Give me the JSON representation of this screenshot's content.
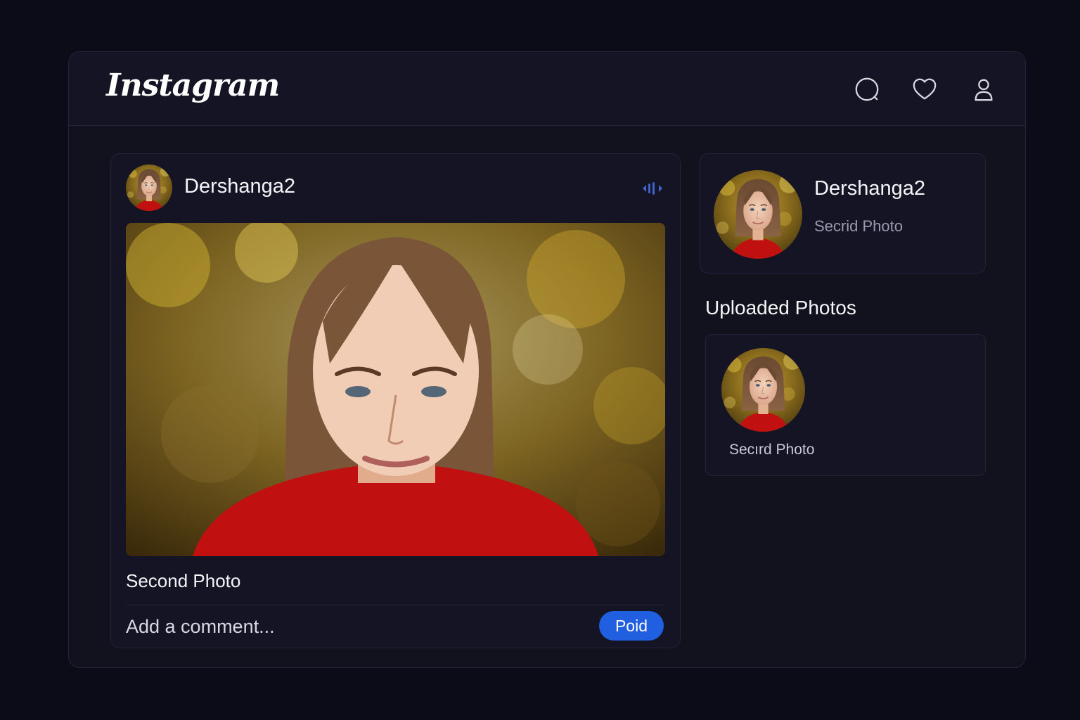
{
  "header": {
    "logo_text": "Instagram",
    "icons": [
      "search-icon",
      "heart-icon",
      "profile-icon"
    ]
  },
  "post": {
    "username": "Dershanga2",
    "caption": "Second Photo",
    "comment_placeholder": "Add a comment...",
    "post_button_label": "Poid"
  },
  "profile_card": {
    "username": "Dershanga2",
    "subtitle": "Secrid Photo"
  },
  "uploaded": {
    "heading": "Uploaded Photos",
    "items": [
      {
        "label": "Secırd Photo"
      }
    ]
  },
  "colors": {
    "background": "#0c0c18",
    "panel": "#141425",
    "accent": "#1f5fe0",
    "sweater_red": "#c0100f"
  }
}
